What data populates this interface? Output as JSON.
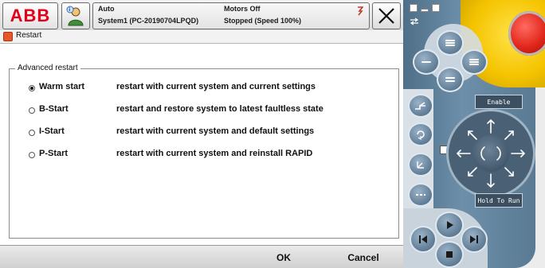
{
  "topbar": {
    "logo_text": "ABB",
    "status_mode": "Auto",
    "status_system": "System1 (PC-20190704LPQD)",
    "status_motors": "Motors Off",
    "status_state": "Stopped (Speed 100%)"
  },
  "window": {
    "title": "Restart"
  },
  "restart": {
    "group_label": "Advanced restart",
    "selected": "Warm start",
    "options": [
      {
        "name": "Warm start",
        "desc": "restart with current system and current settings"
      },
      {
        "name": "B-Start",
        "desc": "restart and restore system to latest faultless state"
      },
      {
        "name": "I-Start",
        "desc": "restart with current system and default settings"
      },
      {
        "name": "P-Start",
        "desc": "restart with current system and reinstall RAPID"
      }
    ]
  },
  "commands": {
    "ok": "OK",
    "cancel": "Cancel"
  },
  "hardware": {
    "enable_label": "Enable",
    "hold_label": "Hold To Run"
  },
  "colors": {
    "brand_red": "#e2001a",
    "pendant_body": "#5a7a93",
    "pendant_yellow": "#f5c400",
    "estop_red": "#e0251a"
  },
  "icons": {
    "abb_menu": "abb-logo",
    "quickset": "operator-icon",
    "events": "event-log-icon",
    "close": "close-icon",
    "title": "restart-app-icon",
    "play": "play-icon",
    "step_back": "step-backward-icon",
    "step_forward": "step-forward-icon",
    "stop": "stop-icon"
  }
}
